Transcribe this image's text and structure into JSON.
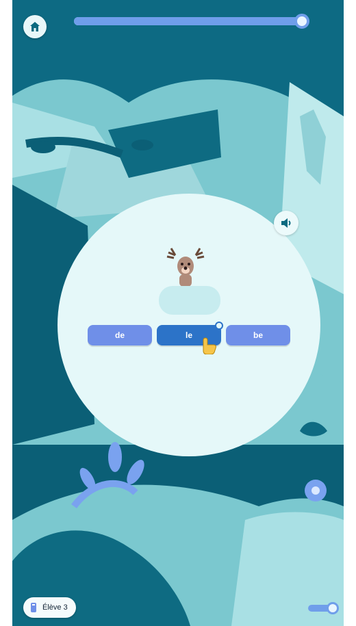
{
  "header": {
    "home_icon": "home-icon",
    "progress_fraction": 0.98
  },
  "activity": {
    "audio_icon": "speaker-icon",
    "animal_icon": "deer-icon",
    "choices": [
      "de",
      "le",
      "be"
    ],
    "selected_index": 1
  },
  "footer": {
    "student_label": "Élève 3",
    "student_icon": "student-icon",
    "volume_fraction": 0.85
  },
  "colors": {
    "accent": "#6f8fe8",
    "selected": "#2c73c8",
    "teal_dark": "#0d6a83",
    "card": "#e5f8f9"
  }
}
